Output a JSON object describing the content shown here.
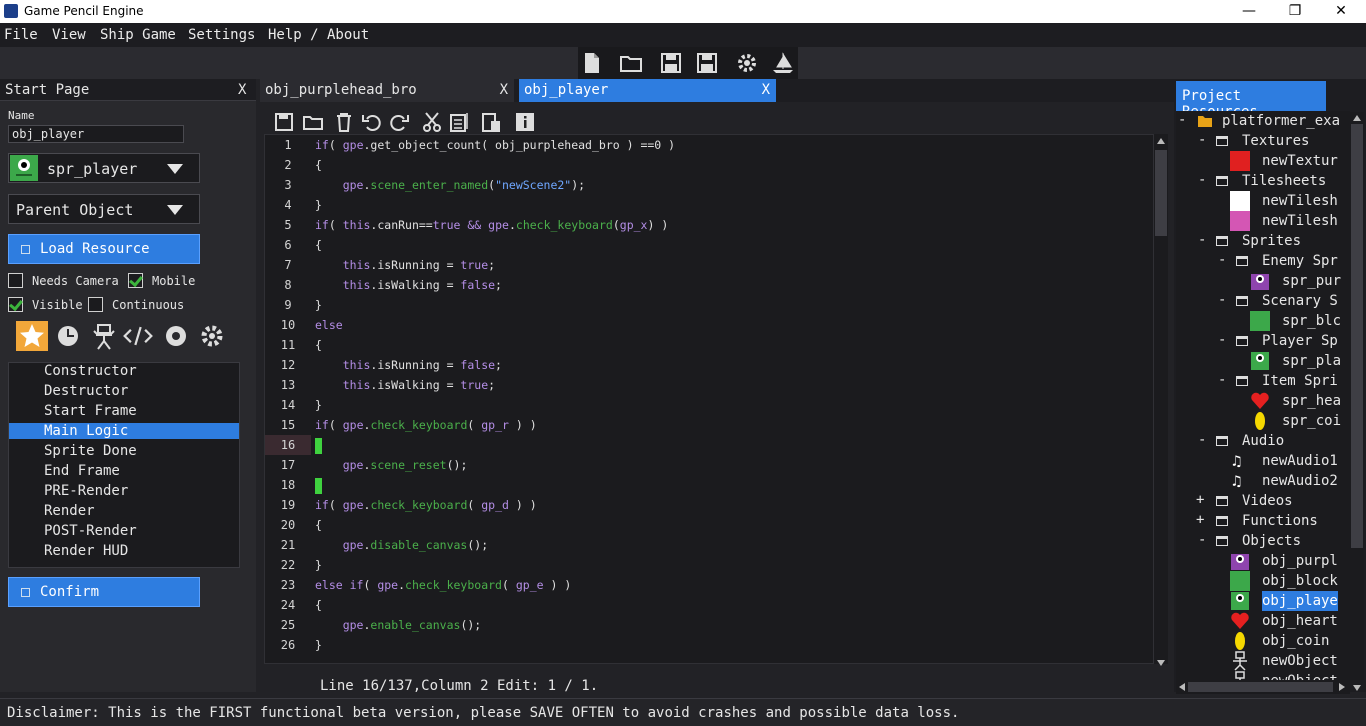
{
  "window": {
    "title": "Game Pencil Engine",
    "minimize": "—",
    "maximize": "❐",
    "close": "✕"
  },
  "menu": [
    "File",
    "View",
    "Ship Game",
    "Settings",
    "Help / About"
  ],
  "toolbar_icons": [
    "new-file-icon",
    "open-folder-icon",
    "save-icon",
    "save-all-icon",
    "settings-gear-icon",
    "ship-sail-icon"
  ],
  "left_panel": {
    "tab_label": "Start Page",
    "tab_close": "X",
    "name_label": "Name",
    "name_value": "obj_player",
    "sprite_dropdown": "spr_player",
    "parent_dropdown": "Parent Object",
    "load_resource": "Load Resource",
    "checkboxes": [
      {
        "label": "Needs Camera",
        "checked": false
      },
      {
        "label": "Mobile",
        "checked": true
      },
      {
        "label": "Visible",
        "checked": true
      },
      {
        "label": "Continuous",
        "checked": false
      }
    ],
    "icon_tabs": [
      "star-icon",
      "clock-icon",
      "robot-icon",
      "code-icon",
      "record-icon",
      "gear-icon"
    ],
    "events": [
      "Constructor",
      "Destructor",
      "Start Frame",
      "Main Logic",
      "Sprite Done",
      "End Frame",
      "PRE-Render",
      "Render",
      "POST-Render",
      "Render HUD"
    ],
    "selected_event": "Main Logic",
    "confirm": "Confirm"
  },
  "editor": {
    "tabs": [
      {
        "label": "obj_purplehead_bro",
        "close": "X",
        "active": false
      },
      {
        "label": "obj_player",
        "close": "X",
        "active": true
      }
    ],
    "tool_icons": [
      "save-icon",
      "open-icon",
      "trash-icon",
      "undo-icon",
      "redo-icon",
      "cut-icon",
      "copy-icon",
      "paste-icon",
      "info-icon"
    ],
    "current_line": 16,
    "status": "Line 16/137,Column 2 Edit: 1 / 1."
  },
  "right_panel": {
    "tab_label": "Project Resources",
    "tree": [
      {
        "label": "platformer_exa",
        "sign": "-",
        "type": "root"
      },
      {
        "label": "Textures",
        "sign": "-",
        "type": "folder"
      },
      {
        "label": "newTextur",
        "type": "item",
        "swatch": "red"
      },
      {
        "label": "Tilesheets",
        "sign": "-",
        "type": "folder"
      },
      {
        "label": "newTilesh",
        "type": "item",
        "swatch": "white"
      },
      {
        "label": "newTilesh",
        "type": "item",
        "swatch": "pink"
      },
      {
        "label": "Sprites",
        "sign": "-",
        "type": "folder"
      },
      {
        "label": "Enemy Spr",
        "sign": "-",
        "type": "subfolder"
      },
      {
        "label": "spr_pur",
        "type": "subitem",
        "swatch": "purple"
      },
      {
        "label": "Scenary S",
        "sign": "-",
        "type": "subfolder"
      },
      {
        "label": "spr_blc",
        "type": "subitem",
        "swatch": "green"
      },
      {
        "label": "Player Sp",
        "sign": "-",
        "type": "subfolder"
      },
      {
        "label": "spr_pla",
        "type": "subitem",
        "swatch": "greenface"
      },
      {
        "label": "Item Spri",
        "sign": "-",
        "type": "subfolder"
      },
      {
        "label": "spr_hea",
        "type": "subitem",
        "swatch": "heart"
      },
      {
        "label": "spr_coi",
        "type": "subitem",
        "swatch": "coin"
      },
      {
        "label": "Audio",
        "sign": "-",
        "type": "folder"
      },
      {
        "label": "newAudio1",
        "type": "item",
        "swatch": "note"
      },
      {
        "label": "newAudio2",
        "type": "item",
        "swatch": "note"
      },
      {
        "label": "Videos",
        "sign": "+",
        "type": "folder"
      },
      {
        "label": "Functions",
        "sign": "+",
        "type": "folder"
      },
      {
        "label": "Objects",
        "sign": "-",
        "type": "folder"
      },
      {
        "label": "obj_purpl",
        "type": "item",
        "swatch": "purple"
      },
      {
        "label": "obj_block",
        "type": "item",
        "swatch": "green"
      },
      {
        "label": "obj_playe",
        "type": "item",
        "swatch": "greenface",
        "selected": true
      },
      {
        "label": "obj_heart",
        "type": "item",
        "swatch": "heart"
      },
      {
        "label": "obj_coin",
        "type": "item",
        "swatch": "coin"
      },
      {
        "label": "newObject",
        "type": "item",
        "swatch": "robot"
      },
      {
        "label": "newObject",
        "type": "item",
        "swatch": "robot"
      }
    ]
  },
  "disclaimer": "Disclaimer: This is the FIRST functional beta version, please SAVE OFTEN to avoid crashes and possible data loss.",
  "colors": {
    "accent": "#2e7de0",
    "keyword": "#b48ee6",
    "function": "#4bb04b",
    "string": "#6fa7ff",
    "cursor": "#3fd23f"
  }
}
